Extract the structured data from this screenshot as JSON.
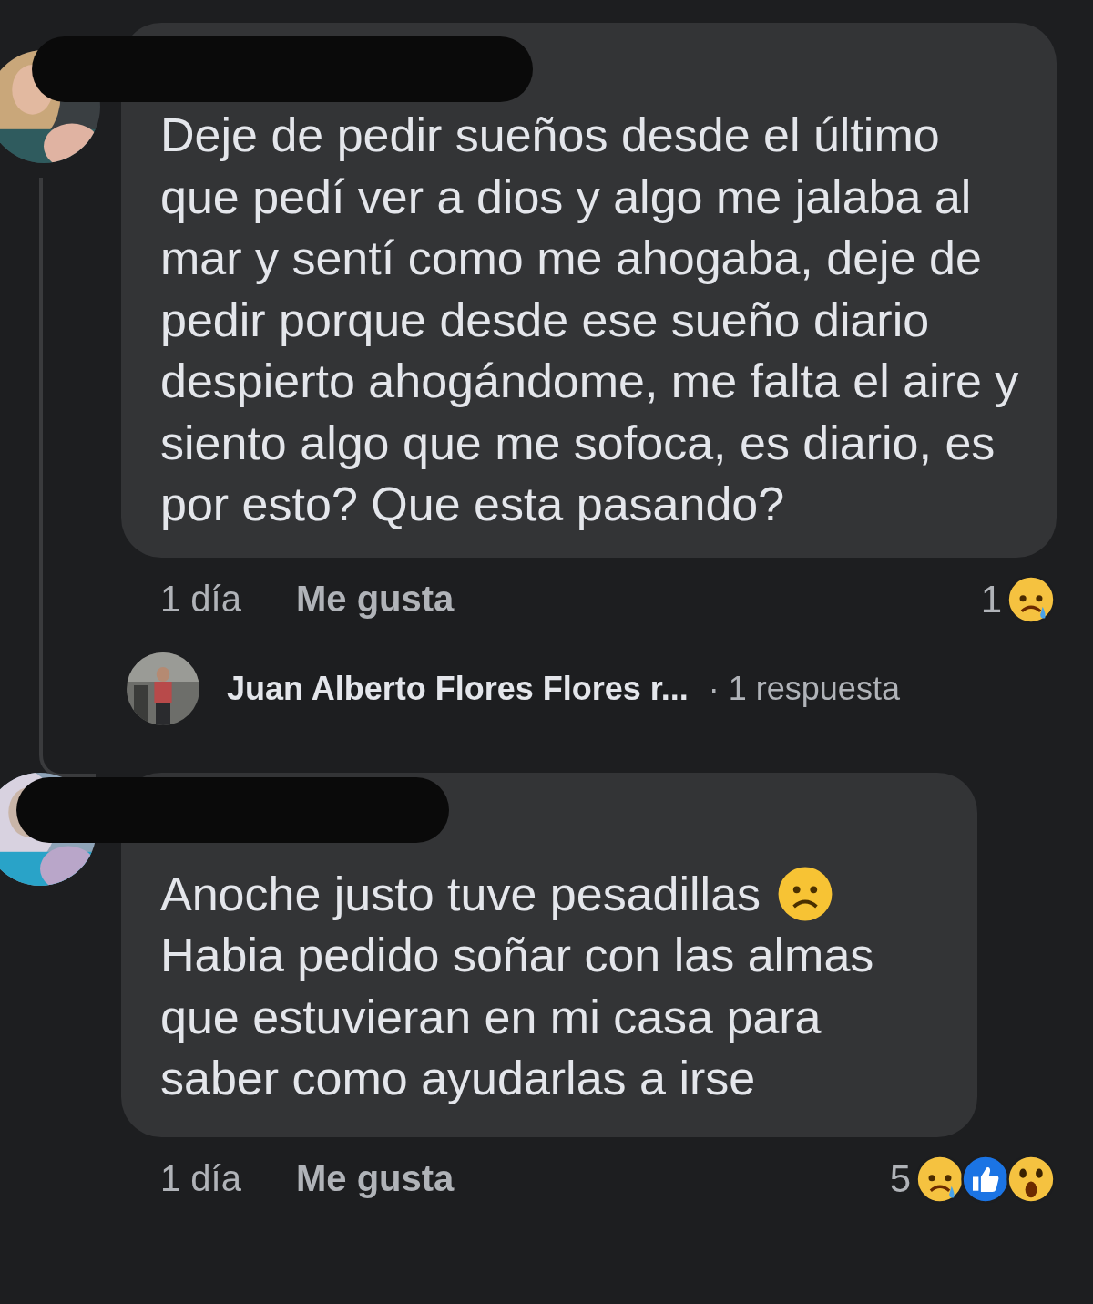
{
  "comments": [
    {
      "name_redacted": true,
      "paragraphs": [
        {
          "text": "Deje de pedir sueños desde el último que pedí ver a dios y algo me jalaba al mar y sentí como me ahogaba, deje de pedir porque desde ese sueño diario despierto ahogándome, me falta el aire y siento algo que me sofoca, es diario, es por esto? Que esta pasando?"
        }
      ],
      "time": "1 día",
      "like_label": "Me gusta",
      "reaction_count": "1",
      "reactions": [
        {
          "kind": "sad"
        }
      ],
      "reply": {
        "name": "Juan Alberto Flores Flores r...",
        "count": "· 1 respuesta"
      }
    },
    {
      "name_redacted": true,
      "paragraphs": [
        {
          "text": "Anoche justo tuve pesadillas",
          "kind": "with_frown"
        },
        {
          "text": "Habia pedido soñar con las almas que estuvieran en mi casa para saber como ayudarlas a irse"
        }
      ],
      "time": "1 día",
      "like_label": "Me gusta",
      "reaction_count": "5",
      "reactions": [
        {
          "kind": "sad"
        },
        {
          "kind": "like"
        },
        {
          "kind": "wow"
        }
      ]
    }
  ]
}
